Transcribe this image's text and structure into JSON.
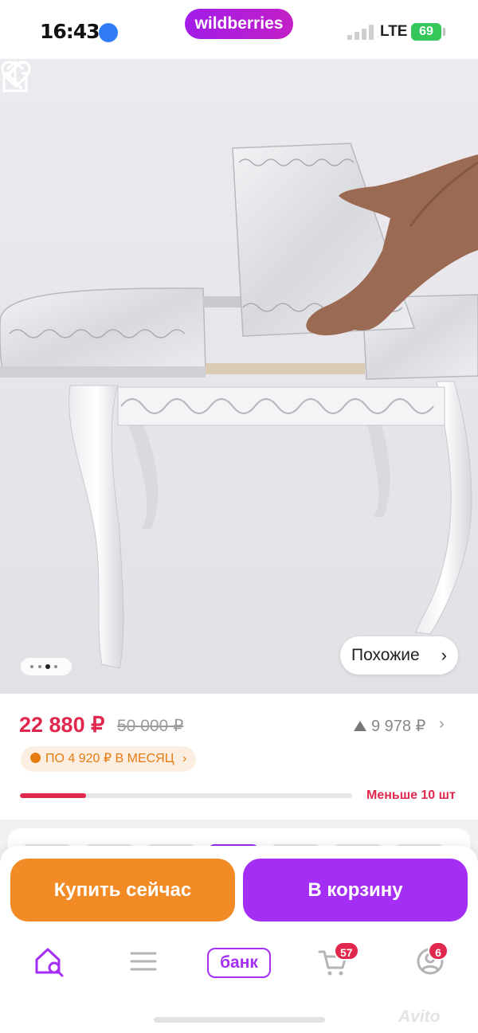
{
  "status_bar": {
    "time": "16:43",
    "carrier_brand": "wildberries",
    "network": "LTE",
    "battery": "69"
  },
  "product_image": {
    "back_icon": "back-arrow-icon",
    "favorite_icon": "heart-icon",
    "share_icon": "share-icon",
    "similar_label": "Похожие",
    "similar_chevron": "›",
    "gallery_total": 4,
    "gallery_active": 3
  },
  "price": {
    "current": "22 880 ₽",
    "old": "50 000 ₽",
    "delta": "9 978 ₽",
    "delta_chevron": "›",
    "installment": "ПО 4 920 ₽ В МЕСЯЦ",
    "installment_chevron": "›",
    "stock_label": "Меньше 10 шт",
    "stock_level": 0.2
  },
  "actions": {
    "buy_now": "Купить сейчас",
    "add_to_cart": "В корзину"
  },
  "tab_bar": {
    "items": [
      {
        "name": "home",
        "icon": "home-search-icon"
      },
      {
        "name": "catalog",
        "icon": "menu-icon"
      },
      {
        "name": "bank",
        "label": "банк"
      },
      {
        "name": "cart",
        "icon": "cart-icon",
        "badge": "57"
      },
      {
        "name": "profile",
        "icon": "profile-icon",
        "badge": "6"
      }
    ]
  },
  "watermark": "Avito",
  "colors": {
    "brand_purple": "#a52ef5",
    "buy_orange": "#f28b25",
    "price_red": "#e0284e",
    "installment_orange": "#e57b12"
  }
}
